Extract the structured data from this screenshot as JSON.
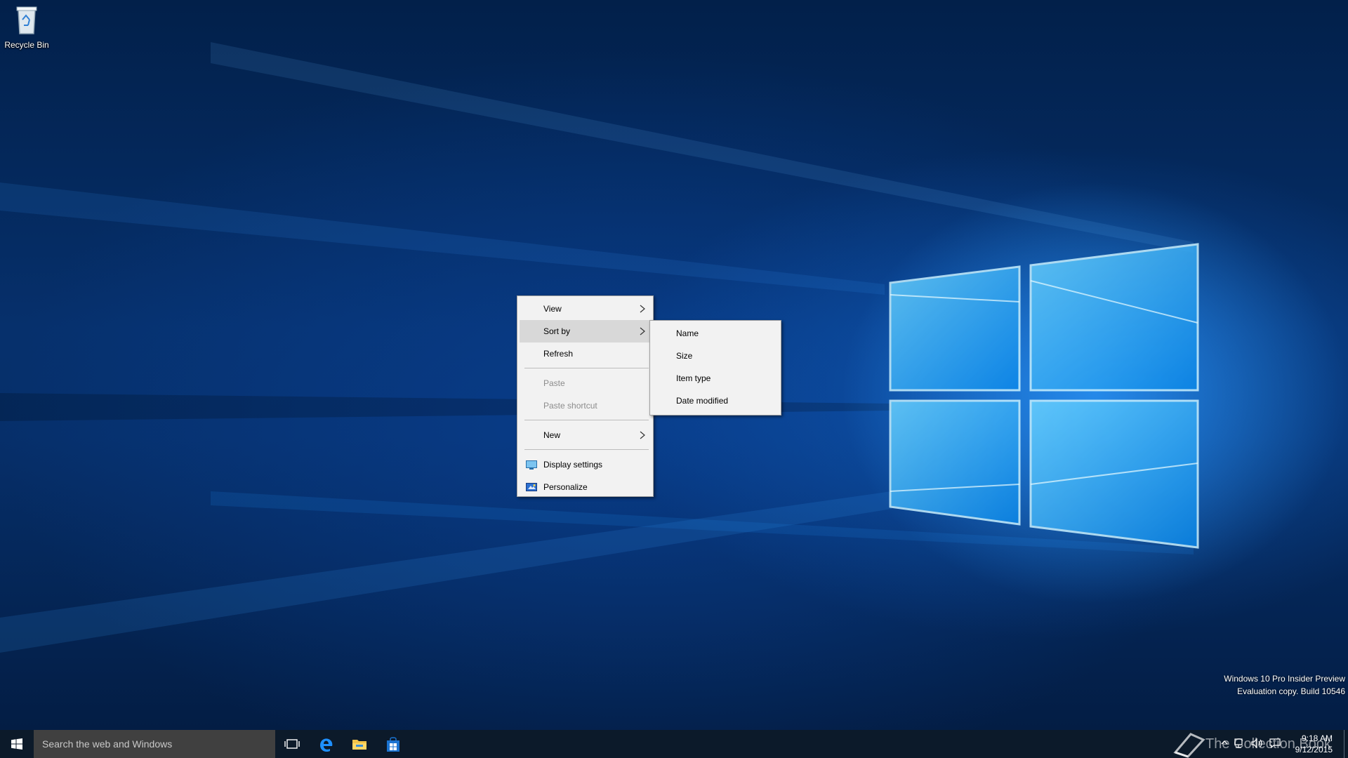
{
  "desktop": {
    "icons": [
      {
        "label": "Recycle Bin",
        "icon": "recycle-bin-icon"
      }
    ]
  },
  "context_menu": {
    "items": [
      {
        "label": "View",
        "has_submenu": true,
        "state": "normal"
      },
      {
        "label": "Sort by",
        "has_submenu": true,
        "state": "active"
      },
      {
        "label": "Refresh",
        "has_submenu": false,
        "state": "normal"
      },
      {
        "label": "Paste",
        "has_submenu": false,
        "state": "disabled"
      },
      {
        "label": "Paste shortcut",
        "has_submenu": false,
        "state": "disabled"
      },
      {
        "label": "New",
        "has_submenu": true,
        "state": "normal"
      },
      {
        "label": "Display settings",
        "has_submenu": false,
        "state": "normal",
        "icon": "display-settings-icon"
      },
      {
        "label": "Personalize",
        "has_submenu": false,
        "state": "normal",
        "icon": "personalize-icon"
      }
    ]
  },
  "sort_submenu": {
    "items": [
      {
        "label": "Name"
      },
      {
        "label": "Size"
      },
      {
        "label": "Item type"
      },
      {
        "label": "Date modified"
      }
    ]
  },
  "watermark": {
    "line1": "Windows 10 Pro Insider Preview",
    "line2": "Evaluation copy. Build 10546"
  },
  "taskbar": {
    "search_placeholder": "Search the web and Windows",
    "pinned": [
      "task-view-icon",
      "edge-icon",
      "file-explorer-icon",
      "store-icon"
    ],
    "brand_text": "The Collection Book",
    "clock": {
      "time": "9:18 AM",
      "date": "9/12/2015"
    }
  },
  "colors": {
    "accent": "#0078d7",
    "taskbar": "#0c1a2a",
    "search_box": "#404040",
    "menu_bg": "#f2f2f2",
    "menu_active": "#d8d8d8",
    "disabled_text": "#8c8c8c"
  }
}
